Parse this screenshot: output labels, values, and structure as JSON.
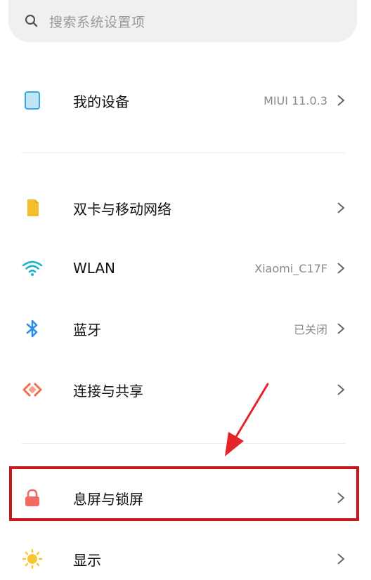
{
  "search": {
    "placeholder": "搜索系统设置项",
    "icon": "search-icon"
  },
  "items": [
    {
      "id": "my-device",
      "label": "我的设备",
      "value": "MIUI 11.0.3",
      "icon": "phone-icon",
      "icon_color": "#38a7e3"
    },
    {
      "id": "dual-sim",
      "label": "双卡与移动网络",
      "value": "",
      "icon": "sim-card-icon",
      "icon_color": "#f4be2a"
    },
    {
      "id": "wlan",
      "label": "WLAN",
      "value": "Xiaomi_C17F",
      "icon": "wifi-icon",
      "icon_color": "#1fb3c9"
    },
    {
      "id": "bluetooth",
      "label": "蓝牙",
      "value": "已关闭",
      "icon": "bluetooth-icon",
      "icon_color": "#2f8fe6"
    },
    {
      "id": "connection-sharing",
      "label": "连接与共享",
      "value": "",
      "icon": "share-icon",
      "icon_color": "#ef7048"
    },
    {
      "id": "lock-screen",
      "label": "息屏与锁屏",
      "value": "",
      "icon": "lock-icon",
      "icon_color": "#f06b62"
    },
    {
      "id": "display",
      "label": "显示",
      "value": "",
      "icon": "sun-icon",
      "icon_color": "#f7c531"
    }
  ],
  "annotation": {
    "highlight_color": "#c8181e",
    "arrow_color": "#e5232a"
  }
}
